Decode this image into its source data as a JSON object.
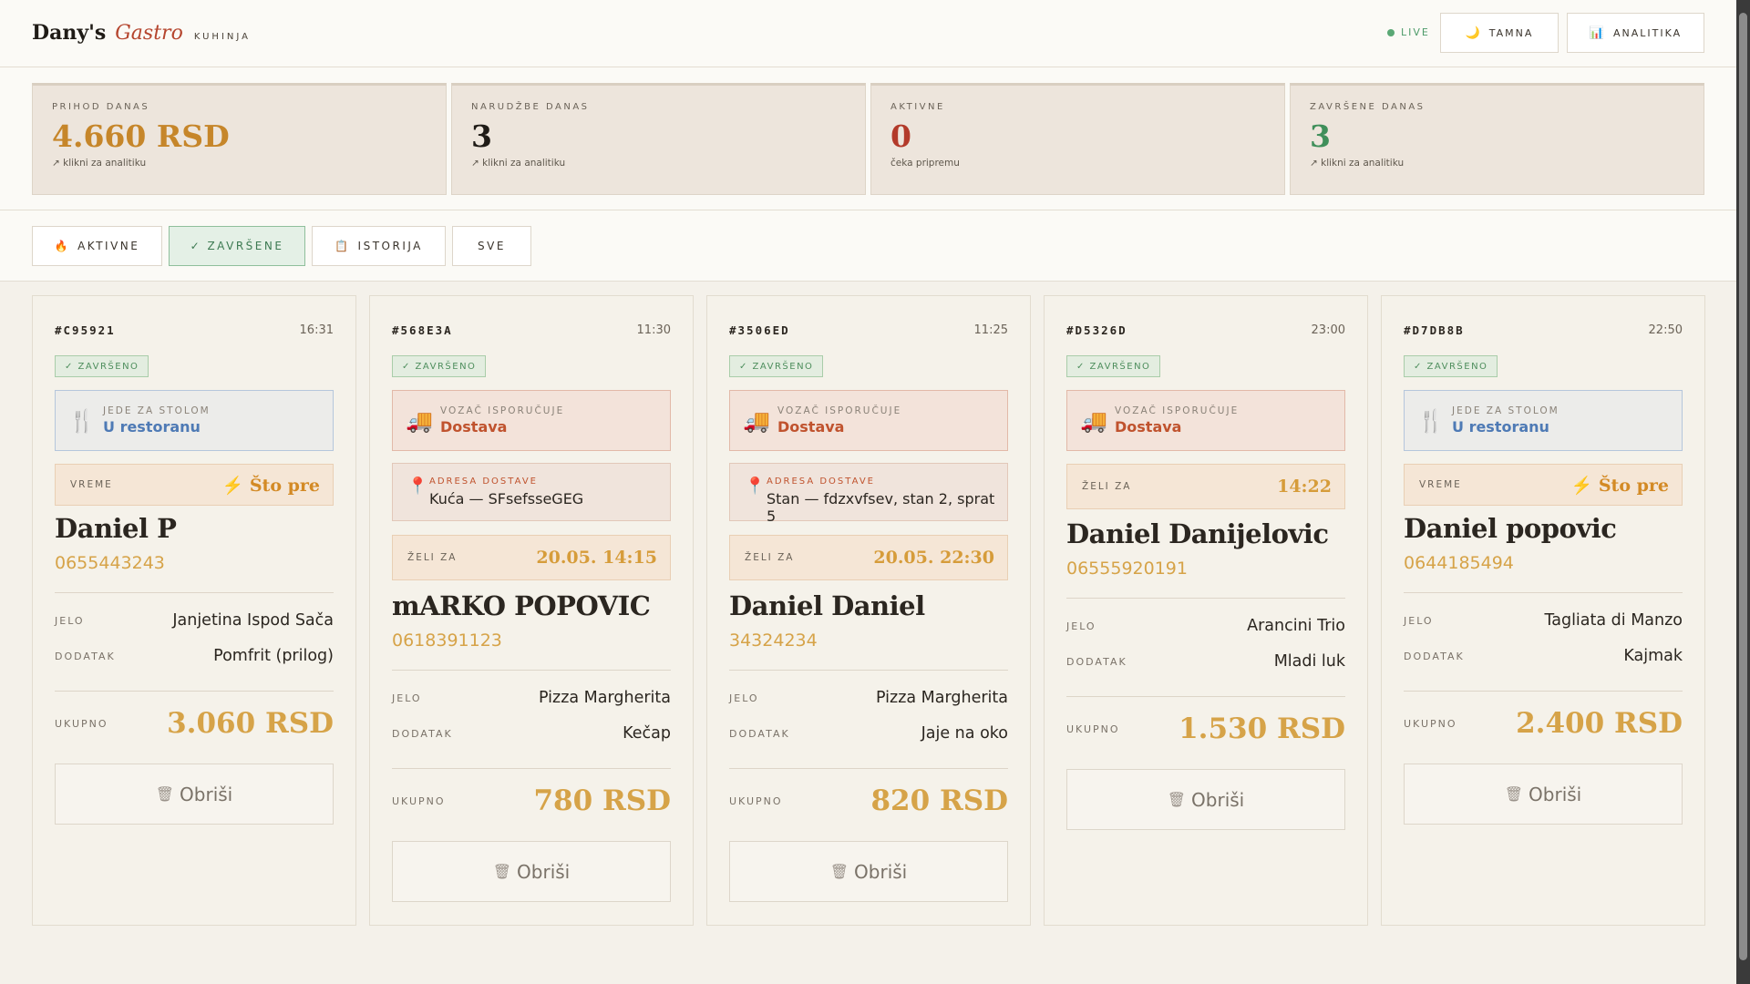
{
  "header": {
    "brand_1": "Dany's",
    "brand_2": "Gastro",
    "brand_3": "KUHINJA",
    "live": "LIVE",
    "dark_btn": "TAMNA",
    "analytics_btn": "ANALITIKA"
  },
  "stats": [
    {
      "label": "PRIHOD DANAS",
      "value": "4.660 RSD",
      "sub": "↗ klikni za analitiku",
      "color": "#c6862a"
    },
    {
      "label": "NARUDŽBE DANAS",
      "value": "3",
      "sub": "↗ klikni za analitiku",
      "color": "#1f1b16"
    },
    {
      "label": "AKTIVNE",
      "value": "0",
      "sub": "čeka pripremu",
      "color": "#b33a2a"
    },
    {
      "label": "ZAVRŠENE DANAS",
      "value": "3",
      "sub": "↗ klikni za analitiku",
      "color": "#3f8f5a"
    }
  ],
  "filters": {
    "active": "AKTIVNE",
    "done": "✓ ZAVRŠENE",
    "history": "ISTORIJA",
    "all": "SVE"
  },
  "labels": {
    "badge": "✓ ZAVRŠENO",
    "rest_label": "JEDE ZA STOLOM",
    "rest_value": "U restoranu",
    "deliv_label": "VOZAČ ISPORUČUJE",
    "deliv_value": "Dostava",
    "addr_label": "ADRESA DOSTAVE",
    "time_label": "VREME",
    "want_label": "ŽELI ZA",
    "asap": "Što pre",
    "food": "JELO",
    "extra": "DODATAK",
    "total": "UKUPNO",
    "delete": "Obriši"
  },
  "orders": [
    {
      "id": "#C95921",
      "time": "16:31",
      "customer": "Daniel P",
      "phone": "0655443243",
      "food": "Janjetina Ispod Sača",
      "extra": "Pomfrit (prilog)",
      "total": "3.060 RSD"
    },
    {
      "id": "#568E3A",
      "time": "11:30",
      "address": "Kuća — SFsefsseGEG",
      "wanted": "20.05. 14:15",
      "customer": "mARKO POPOVIC",
      "phone": "0618391123",
      "food": "Pizza Margherita",
      "extra": "Kečap",
      "total": "780 RSD"
    },
    {
      "id": "#3506ED",
      "time": "11:25",
      "address": "Stan — fdzxvfsev, stan 2, sprat 5",
      "wanted": "20.05. 22:30",
      "customer": "Daniel Daniel",
      "phone": "34324234",
      "food": "Pizza Margherita",
      "extra": "Jaje na oko",
      "total": "820 RSD"
    },
    {
      "id": "#D5326D",
      "time": "23:00",
      "wanted": "14:22",
      "customer": "Daniel Danijelovic",
      "phone": "06555920191",
      "food": "Arancini Trio",
      "extra": "Mladi luk",
      "total": "1.530 RSD"
    },
    {
      "id": "#D7DB8B",
      "time": "22:50",
      "customer": "Daniel popovic",
      "phone": "0644185494",
      "food": "Tagliata di Manzo",
      "extra": "Kajmak",
      "total": "2.400 RSD"
    }
  ],
  "icons": {
    "live": "dot-icon",
    "dark": "moon-icon",
    "analytics": "chart-icon",
    "active_filter": "flame-icon",
    "history_filter": "clipboard-icon",
    "restaurant": "fork-knife-icon",
    "delivery": "truck-icon",
    "address": "pin-icon",
    "asap": "bolt-icon",
    "delete": "trash-icon"
  }
}
